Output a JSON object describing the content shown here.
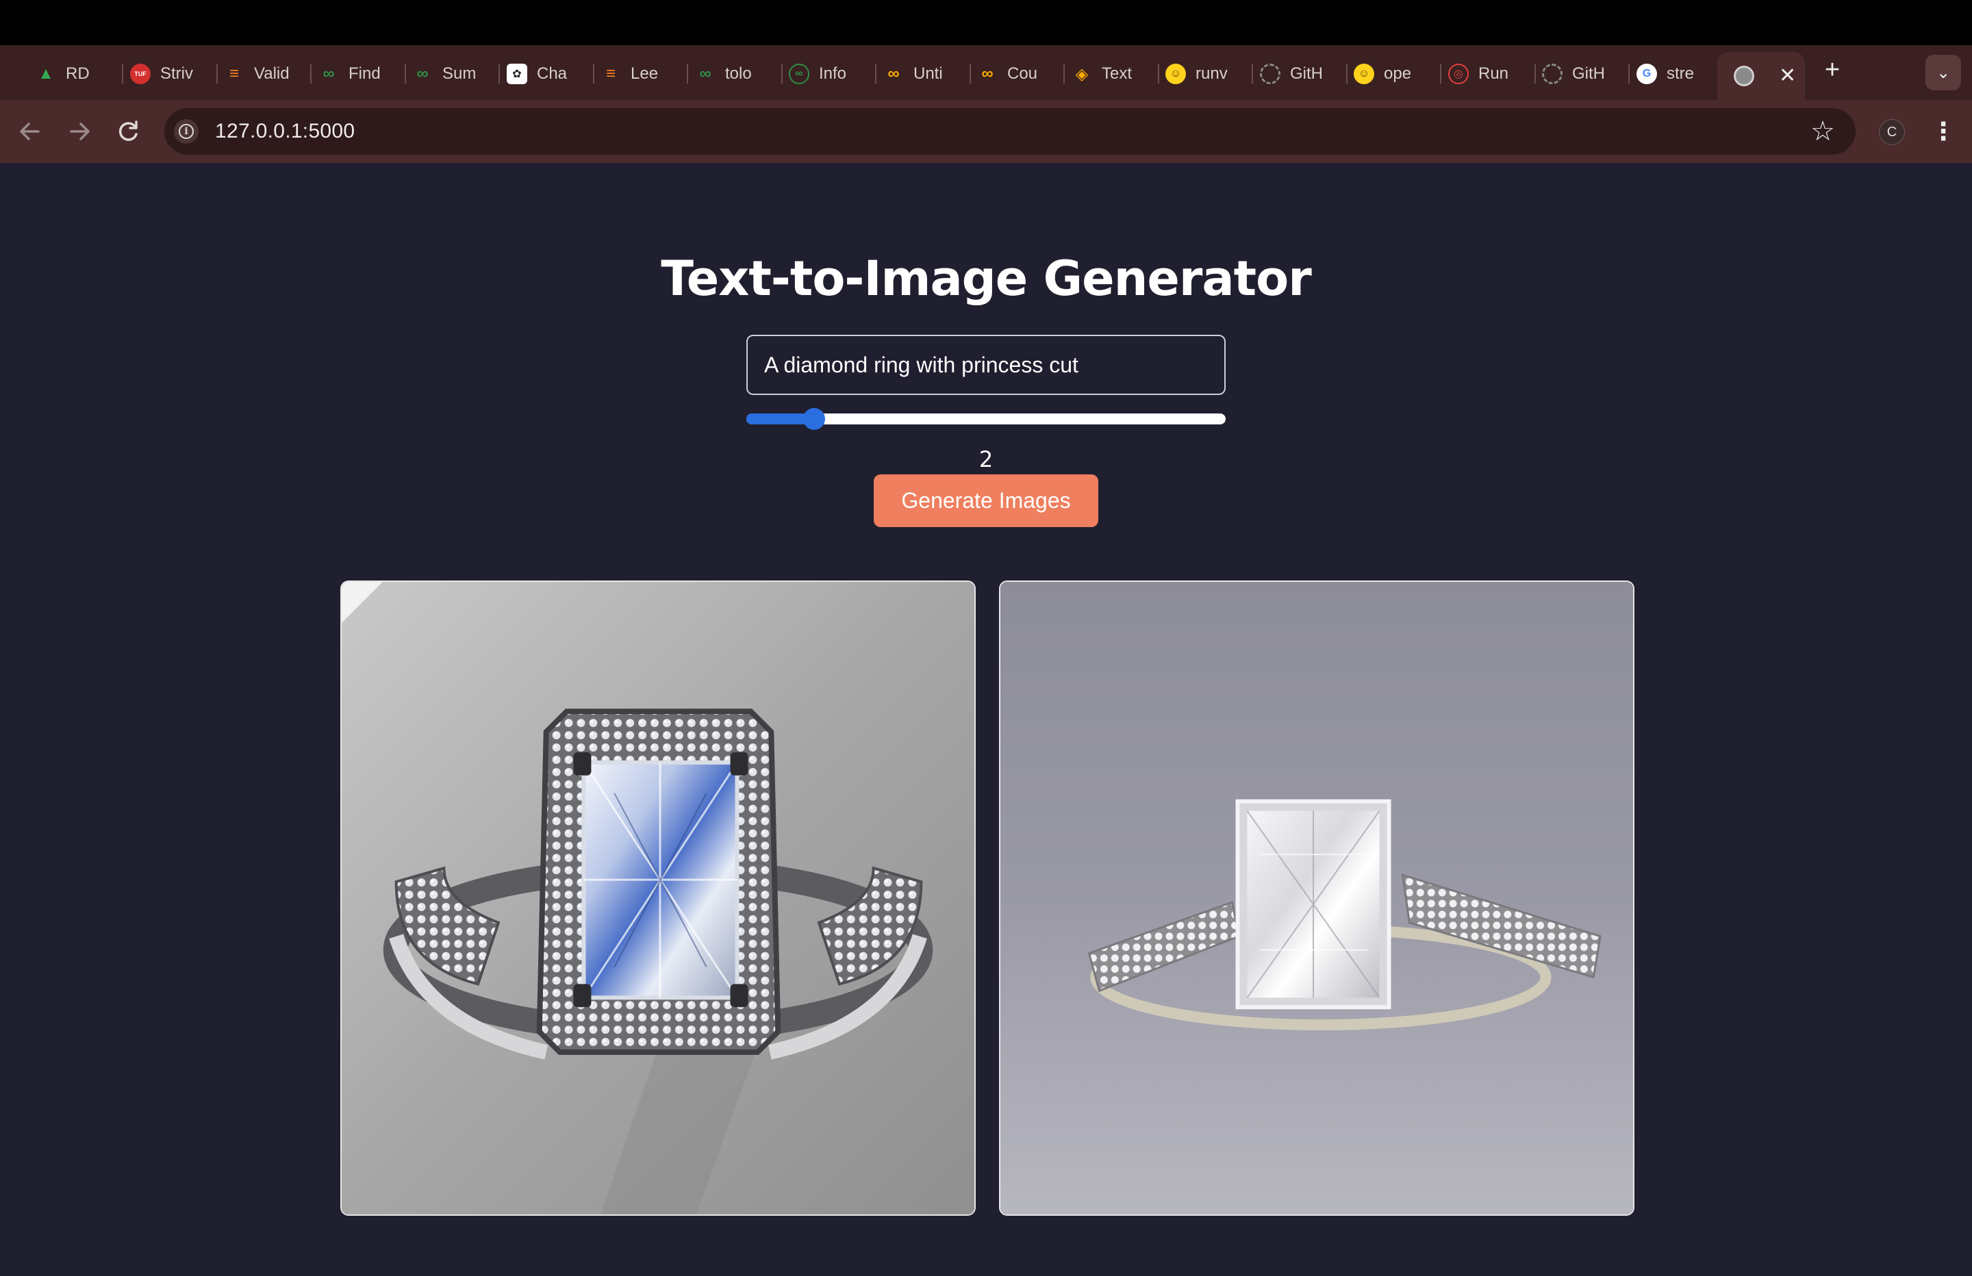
{
  "browser": {
    "tabs": [
      {
        "label": "RD",
        "icon": "drive-icon",
        "color": "#34a853"
      },
      {
        "label": "Striv",
        "icon": "tuf-icon",
        "color": "#d32f2f"
      },
      {
        "label": "Valid",
        "icon": "stack-icon",
        "color": "#f48024"
      },
      {
        "label": "Find",
        "icon": "gfg-icon",
        "color": "#2f8d46"
      },
      {
        "label": "Sum",
        "icon": "gfg-icon",
        "color": "#2f8d46"
      },
      {
        "label": "Cha",
        "icon": "openai-icon",
        "color": "#ffffff"
      },
      {
        "label": "Lee",
        "icon": "stack-icon",
        "color": "#f48024"
      },
      {
        "label": "tolo",
        "icon": "gfg-icon",
        "color": "#2f8d46"
      },
      {
        "label": "Info",
        "icon": "gfg-ring-icon",
        "color": "#2f8d46"
      },
      {
        "label": "Unti",
        "icon": "colab-icon",
        "color": "#f9ab00"
      },
      {
        "label": "Cou",
        "icon": "colab-icon",
        "color": "#f9ab00"
      },
      {
        "label": "Text",
        "icon": "layers-icon",
        "color": "#f9ab00"
      },
      {
        "label": "runv",
        "icon": "huggingface-icon",
        "color": "#ffd21e"
      },
      {
        "label": "GitH",
        "icon": "loading-icon",
        "color": "#888888"
      },
      {
        "label": "ope",
        "icon": "huggingface-icon",
        "color": "#ffd21e"
      },
      {
        "label": "Run",
        "icon": "replicate-icon",
        "color": "#e04040"
      },
      {
        "label": "GitH",
        "icon": "loading-icon",
        "color": "#888888"
      },
      {
        "label": "stre",
        "icon": "google-icon",
        "color": "#4285f4"
      }
    ],
    "active_tab_close": "✕",
    "new_tab": "+",
    "tab_search": "⌄",
    "url": "127.0.0.1:5000",
    "profile_initial": "C"
  },
  "page": {
    "title": "Text-to-Image Generator",
    "prompt_value": "A diamond ring with princess cut",
    "slider_value": "2",
    "slider_fraction": 0.13,
    "generate_label": "Generate Images"
  }
}
